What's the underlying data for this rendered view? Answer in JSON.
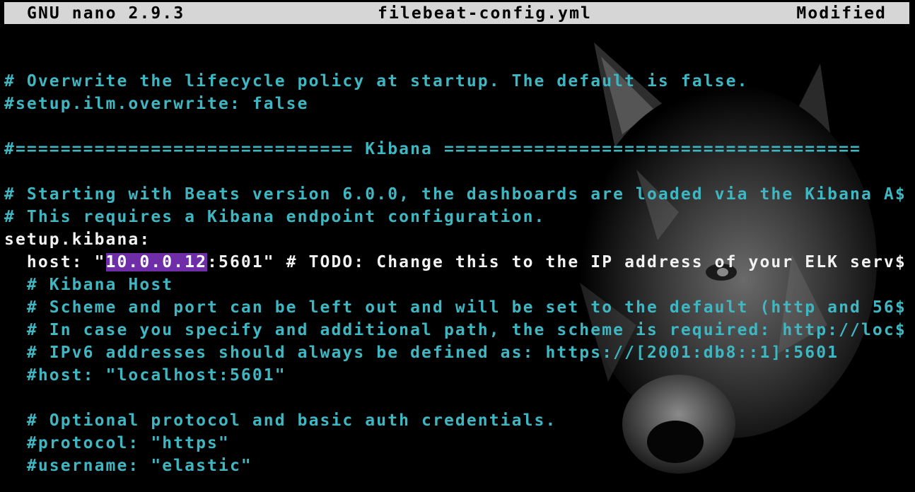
{
  "titlebar": {
    "app": "GNU nano 2.9.3",
    "filename": "filebeat-config.yml",
    "status": "Modified"
  },
  "colors": {
    "comment": "#3fb7c2",
    "text": "#f2f2f2",
    "titlebar_bg": "#d6d6d6",
    "selection": "#6f2ea8",
    "background": "#000000"
  },
  "lines": {
    "l02": "# Overwrite the lifecycle policy at startup. The default is false.",
    "l03": "#setup.ilm.overwrite: false",
    "l05": "#============================== Kibana =====================================",
    "l07": "# Starting with Beats version 6.0.0, the dashboards are loaded via the Kibana A$",
    "l08": "# This requires a Kibana endpoint configuration.",
    "l09": "setup.kibana:",
    "l10": {
      "before": "  host: \"",
      "selected": "10.0.0.12",
      "after": ":5601\" # TODO: Change this to the IP address of your ELK serv$"
    },
    "l11": "  # Kibana Host",
    "l12": "  # Scheme and port can be left out and will be set to the default (http and 56$",
    "l13": "  # In case you specify and additional path, the scheme is required: http://loc$",
    "l14": "  # IPv6 addresses should always be defined as: https://[2001:db8::1]:5601",
    "l15": "  #host: \"localhost:5601\"",
    "l17": "  # Optional protocol and basic auth credentials.",
    "l18": "  #protocol: \"https\"",
    "l19": "  #username: \"elastic\""
  }
}
